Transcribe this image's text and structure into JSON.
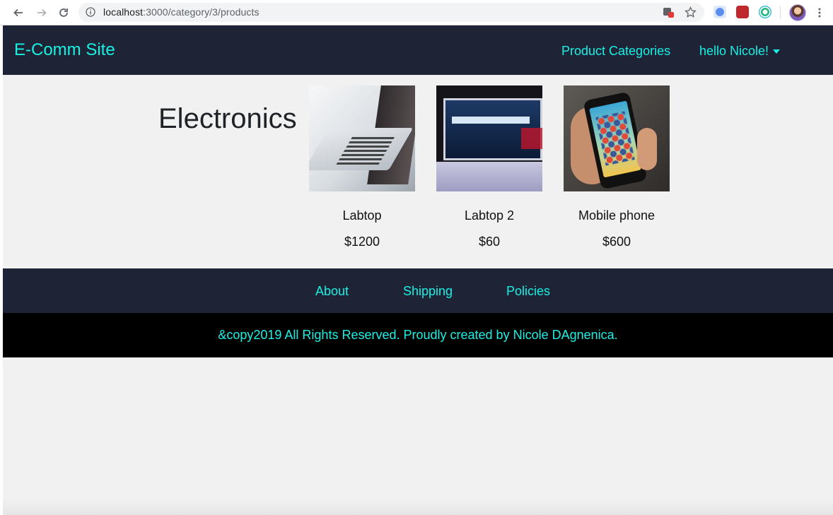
{
  "browser": {
    "url_host": "localhost",
    "url_path": ":3000/category/3/products"
  },
  "navbar": {
    "brand": "E-Comm Site",
    "product_categories": "Product Categories",
    "user_greeting": "hello Nicole!"
  },
  "category": {
    "title": "Electronics"
  },
  "products": [
    {
      "name": "Labtop",
      "price": "$1200"
    },
    {
      "name": "Labtop 2",
      "price": "$60"
    },
    {
      "name": "Mobile phone",
      "price": "$600"
    }
  ],
  "footer": {
    "links": [
      "About",
      "Shipping",
      "Policies"
    ],
    "copyright": "&copy2019 All Rights Reserved. Proudly created by Nicole DAgnenica."
  },
  "colors": {
    "nav_bg": "#1e2436",
    "accent": "#19f0e4",
    "page_bg": "#f1f1f1",
    "copyright_bg": "#000000"
  },
  "icons": [
    "back-arrow-icon",
    "forward-arrow-icon",
    "reload-icon",
    "info-icon",
    "translate-icon",
    "star-icon",
    "extension-icon",
    "menu-dots-icon",
    "caret-down-icon"
  ]
}
